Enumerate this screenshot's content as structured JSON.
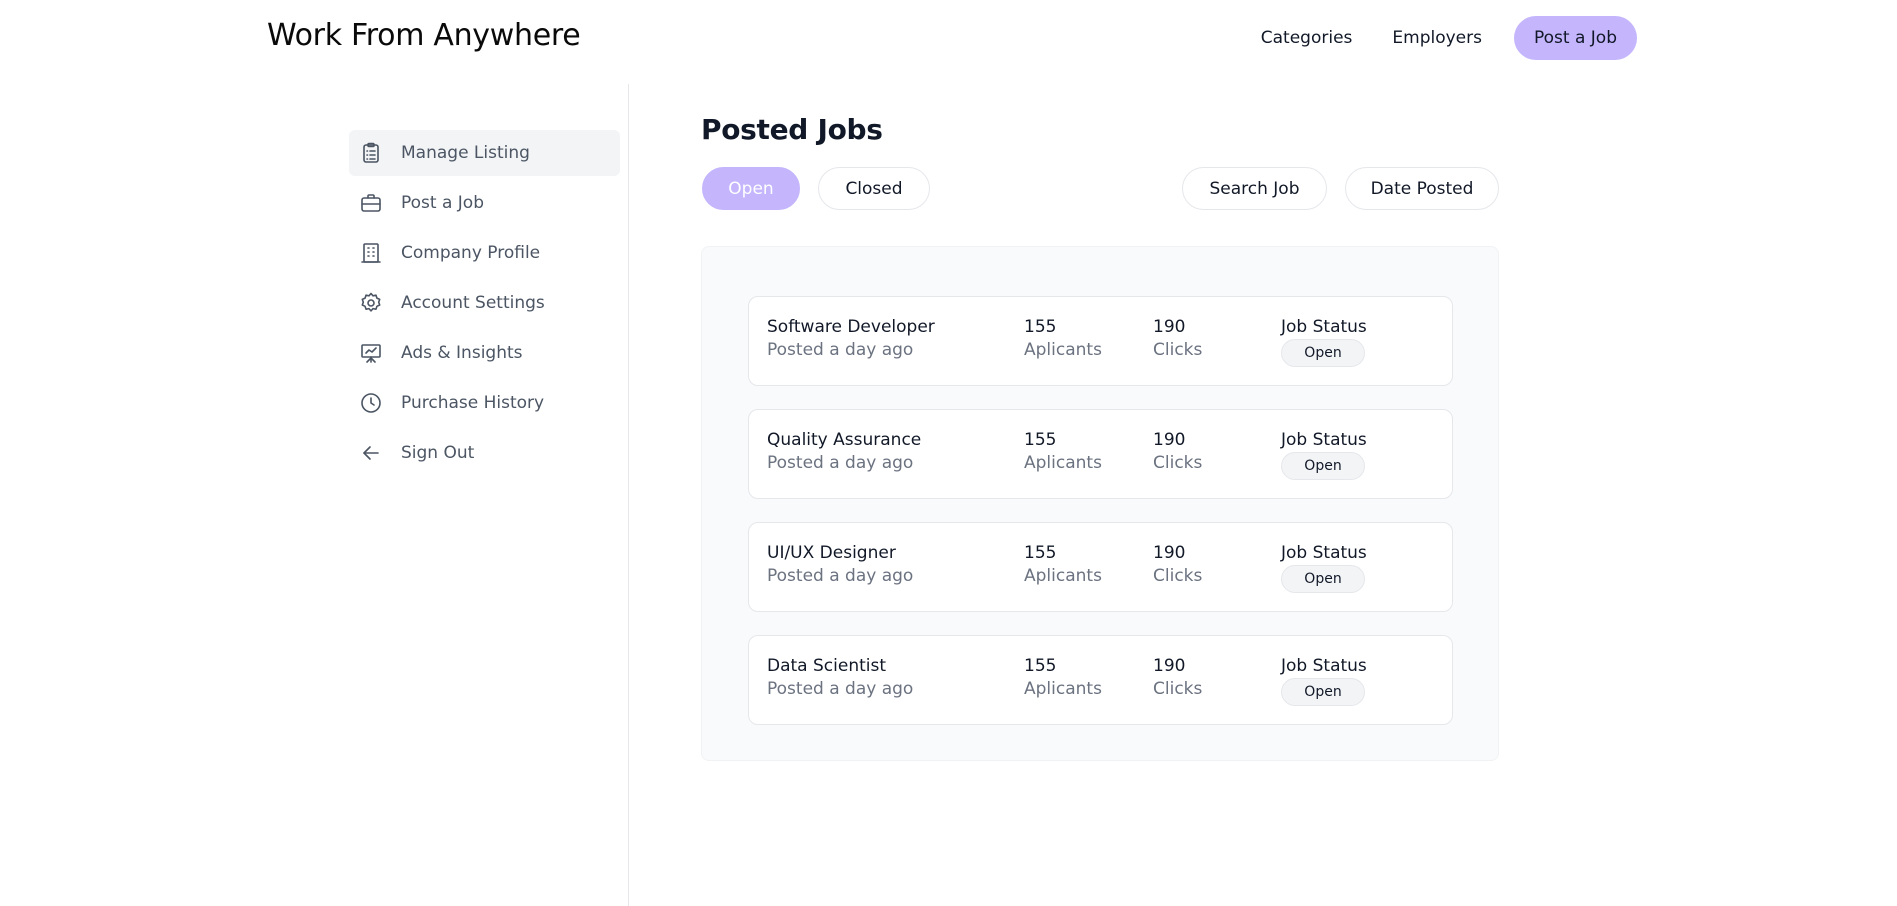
{
  "header": {
    "brand": "Work From Anywhere",
    "nav": {
      "categories": "Categories",
      "employers": "Employers",
      "post_job": "Post a Job"
    }
  },
  "sidebar": {
    "items": [
      {
        "label": "Manage Listing",
        "icon": "clipboard-icon",
        "active": true
      },
      {
        "label": "Post a Job",
        "icon": "briefcase-icon"
      },
      {
        "label": "Company Profile",
        "icon": "building-icon"
      },
      {
        "label": "Account Settings",
        "icon": "gear-icon"
      },
      {
        "label": "Ads & Insights",
        "icon": "presentation-icon"
      },
      {
        "label": "Purchase History",
        "icon": "clock-icon"
      },
      {
        "label": "Sign Out",
        "icon": "arrow-left-icon"
      }
    ]
  },
  "main": {
    "title": "Posted Jobs",
    "tabs": {
      "open": "Open",
      "closed": "Closed"
    },
    "filters": {
      "search": "Search Job",
      "date": "Date Posted"
    },
    "jobs": [
      {
        "title": "Software Developer",
        "posted": "Posted a day ago",
        "applicants": "155",
        "applicants_label": "Aplicants",
        "clicks": "190",
        "clicks_label": "Clicks",
        "status_label": "Job Status",
        "status": "Open"
      },
      {
        "title": "Quality Assurance",
        "posted": "Posted a day ago",
        "applicants": "155",
        "applicants_label": "Aplicants",
        "clicks": "190",
        "clicks_label": "Clicks",
        "status_label": "Job Status",
        "status": "Open"
      },
      {
        "title": "UI/UX Designer",
        "posted": "Posted a day ago",
        "applicants": "155",
        "applicants_label": "Aplicants",
        "clicks": "190",
        "clicks_label": "Clicks",
        "status_label": "Job Status",
        "status": "Open"
      },
      {
        "title": "Data Scientist",
        "posted": "Posted a day ago",
        "applicants": "155",
        "applicants_label": "Aplicants",
        "clicks": "190",
        "clicks_label": "Clicks",
        "status_label": "Job Status",
        "status": "Open"
      }
    ]
  },
  "colors": {
    "accent": "#c4b5fd",
    "panel_bg": "#f9fafb",
    "muted_text": "#6b7280"
  }
}
